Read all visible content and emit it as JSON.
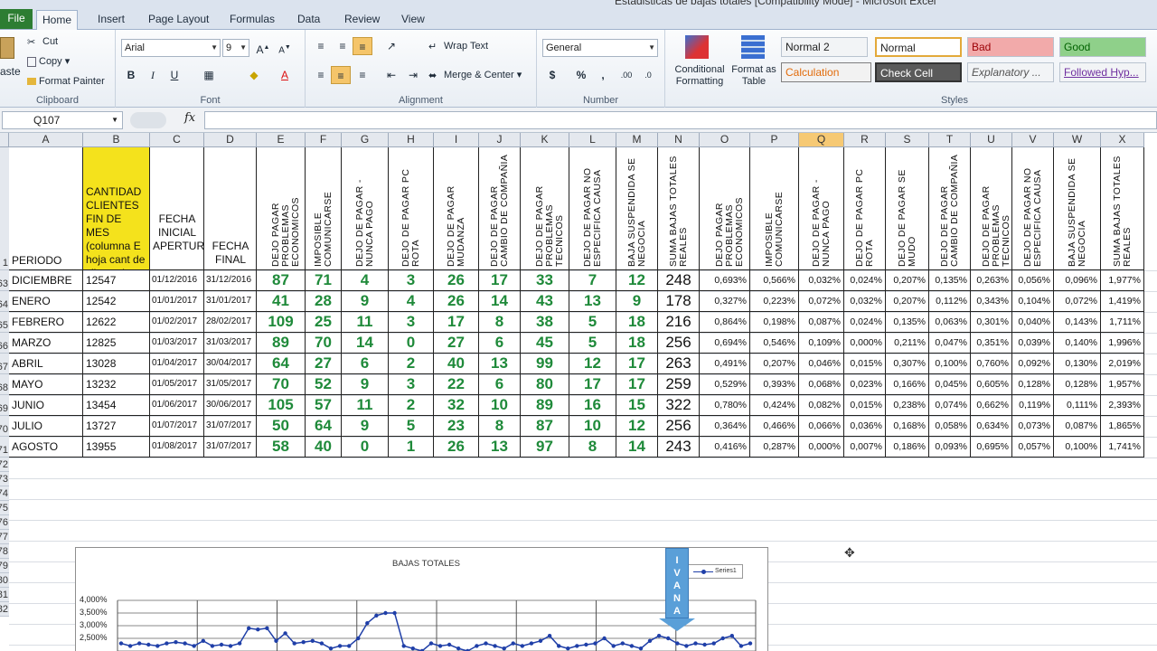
{
  "window": {
    "title": "Estadisticas de bajas totales [Compatibility Mode] - Microsoft Excel"
  },
  "ribbon_tabs": [
    "File",
    "Home",
    "Insert",
    "Page Layout",
    "Formulas",
    "Data",
    "Review",
    "View"
  ],
  "clipboard": {
    "paste": "aste",
    "cut": "Cut",
    "copy": "Copy",
    "format_painter": "Format Painter",
    "label": "Clipboard"
  },
  "font": {
    "name": "Arial",
    "size": "9",
    "label": "Font",
    "bold": "B",
    "italic": "I",
    "underline": "U"
  },
  "alignment": {
    "wrap_text": "Wrap Text",
    "merge_center": "Merge & Center",
    "label": "Alignment"
  },
  "number": {
    "format": "General",
    "currency": "$",
    "percent": "%",
    "comma": ",",
    "label": "Number"
  },
  "styles": {
    "conditional_formatting": "Conditional Formatting",
    "format_as_table": "Format as Table",
    "label": "Styles",
    "cells": [
      "Normal 2",
      "Normal",
      "Bad",
      "Good",
      "Calculation",
      "Check Cell",
      "Explanatory ...",
      "Followed Hyp..."
    ]
  },
  "formula_bar": {
    "name_box": "Q107",
    "fx": "fx",
    "value": ""
  },
  "columns": [
    "A",
    "B",
    "C",
    "D",
    "E",
    "F",
    "G",
    "H",
    "I",
    "J",
    "K",
    "L",
    "M",
    "N",
    "O",
    "P",
    "Q",
    "R",
    "S",
    "T",
    "U",
    "V",
    "W",
    "X"
  ],
  "selected_column": "Q",
  "header_row": {
    "row_number": "1",
    "a": "PERIODO",
    "b": "CANTIDAD CLIENTES FIN DE MES (columna E hoja cant de clientes)",
    "c": "FECHA INICIAL APERTURA",
    "d": "FECHA FINAL",
    "vertical": [
      "DEJO PAGAR PROBLEMAS ECONOMICOS",
      "IMPOSIBLE COMUNICARSE",
      "DEJO DE PAGAR - NUNCA PAGO",
      "DEJO DE PAGAR PC ROTA",
      "DEJO DE PAGAR MUDANZA",
      "DEJO DE PAGAR CAMBIO DE COMPAÑIA",
      "DEJO DE PAGAR PROBLEMAS TECNICOS",
      "DEJO DE PAGAR NO ESPECIFICA CAUSA",
      "BAJA SUSPENDIDA SE NEGOCIA",
      "SUMA BAJAS TOTALES REALES",
      "DEJO PAGAR PROBLEMAS ECONOMICOS",
      "IMPOSIBLE COMUNICARSE",
      "DEJO DE PAGAR - NUNCA PAGO",
      "DEJO DE PAGAR PC ROTA",
      "DEJO DE PAGAR SE MUDO",
      "DEJO DE PAGAR CAMBIO DE COMPAÑIA",
      "DEJO DE PAGAR PROBLEMAS TECNICOS",
      "DEJO DE PAGAR NO ESPECIFICA CAUSA",
      "BAJA SUSPENDIDA SE NEGOCIA",
      "SUMA BAJAS TOTALES REALES"
    ]
  },
  "rows": [
    {
      "num": "63",
      "periodo": "DICIEMBRE",
      "clientes": "12547",
      "inicio": "01/12/2016",
      "fin": "31/12/2016",
      "counts": [
        "87",
        "71",
        "4",
        "3",
        "26",
        "17",
        "33",
        "7",
        "12",
        "248"
      ],
      "pcts": [
        "0,693%",
        "0,566%",
        "0,032%",
        "0,024%",
        "0,207%",
        "0,135%",
        "0,263%",
        "0,056%",
        "0,096%",
        "1,977%"
      ]
    },
    {
      "num": "64",
      "periodo": "ENERO",
      "clientes": "12542",
      "inicio": "01/01/2017",
      "fin": "31/01/2017",
      "counts": [
        "41",
        "28",
        "9",
        "4",
        "26",
        "14",
        "43",
        "13",
        "9",
        "178"
      ],
      "pcts": [
        "0,327%",
        "0,223%",
        "0,072%",
        "0,032%",
        "0,207%",
        "0,112%",
        "0,343%",
        "0,104%",
        "0,072%",
        "1,419%"
      ]
    },
    {
      "num": "65",
      "periodo": "FEBRERO",
      "clientes": "12622",
      "inicio": "01/02/2017",
      "fin": "28/02/2017",
      "counts": [
        "109",
        "25",
        "11",
        "3",
        "17",
        "8",
        "38",
        "5",
        "18",
        "216"
      ],
      "pcts": [
        "0,864%",
        "0,198%",
        "0,087%",
        "0,024%",
        "0,135%",
        "0,063%",
        "0,301%",
        "0,040%",
        "0,143%",
        "1,711%"
      ]
    },
    {
      "num": "66",
      "periodo": "MARZO",
      "clientes": "12825",
      "inicio": "01/03/2017",
      "fin": "31/03/2017",
      "counts": [
        "89",
        "70",
        "14",
        "0",
        "27",
        "6",
        "45",
        "5",
        "18",
        "256"
      ],
      "pcts": [
        "0,694%",
        "0,546%",
        "0,109%",
        "0,000%",
        "0,211%",
        "0,047%",
        "0,351%",
        "0,039%",
        "0,140%",
        "1,996%"
      ]
    },
    {
      "num": "67",
      "periodo": "ABRIL",
      "clientes": "13028",
      "inicio": "01/04/2017",
      "fin": "30/04/2017",
      "counts": [
        "64",
        "27",
        "6",
        "2",
        "40",
        "13",
        "99",
        "12",
        "17",
        "263"
      ],
      "pcts": [
        "0,491%",
        "0,207%",
        "0,046%",
        "0,015%",
        "0,307%",
        "0,100%",
        "0,760%",
        "0,092%",
        "0,130%",
        "2,019%"
      ]
    },
    {
      "num": "68",
      "periodo": "MAYO",
      "clientes": "13232",
      "inicio": "01/05/2017",
      "fin": "31/05/2017",
      "counts": [
        "70",
        "52",
        "9",
        "3",
        "22",
        "6",
        "80",
        "17",
        "17",
        "259"
      ],
      "pcts": [
        "0,529%",
        "0,393%",
        "0,068%",
        "0,023%",
        "0,166%",
        "0,045%",
        "0,605%",
        "0,128%",
        "0,128%",
        "1,957%"
      ]
    },
    {
      "num": "69",
      "periodo": "JUNIO",
      "clientes": "13454",
      "inicio": "01/06/2017",
      "fin": "30/06/2017",
      "counts": [
        "105",
        "57",
        "11",
        "2",
        "32",
        "10",
        "89",
        "16",
        "15",
        "322"
      ],
      "pcts": [
        "0,780%",
        "0,424%",
        "0,082%",
        "0,015%",
        "0,238%",
        "0,074%",
        "0,662%",
        "0,119%",
        "0,111%",
        "2,393%"
      ]
    },
    {
      "num": "70",
      "periodo": "JULIO",
      "clientes": "13727",
      "inicio": "01/07/2017",
      "fin": "31/07/2017",
      "counts": [
        "50",
        "64",
        "9",
        "5",
        "23",
        "8",
        "87",
        "10",
        "12",
        "256"
      ],
      "pcts": [
        "0,364%",
        "0,466%",
        "0,066%",
        "0,036%",
        "0,168%",
        "0,058%",
        "0,634%",
        "0,073%",
        "0,087%",
        "1,865%"
      ]
    },
    {
      "num": "71",
      "periodo": "AGOSTO",
      "clientes": "13955",
      "inicio": "01/08/2017",
      "fin": "31/07/2017",
      "counts": [
        "58",
        "40",
        "0",
        "1",
        "26",
        "13",
        "97",
        "8",
        "14",
        "243"
      ],
      "pcts": [
        "0,416%",
        "0,287%",
        "0,000%",
        "0,007%",
        "0,186%",
        "0,093%",
        "0,695%",
        "0,057%",
        "0,100%",
        "1,741%"
      ]
    }
  ],
  "empty_rows": [
    "72",
    "73",
    "74",
    "75",
    "76",
    "77",
    "78",
    "79",
    "80",
    "81",
    "82"
  ],
  "chart": {
    "title": "BAJAS TOTALES",
    "legend": "Series1",
    "yticks": [
      "4,000%",
      "3,500%",
      "3,000%",
      "2,500%"
    ],
    "annotation": "IVANA"
  },
  "chart_data": {
    "type": "line",
    "title": "BAJAS TOTALES",
    "series": [
      {
        "name": "Series1",
        "values": [
          2.3,
          2.2,
          2.3,
          2.25,
          2.2,
          2.3,
          2.35,
          2.3,
          2.2,
          2.4,
          2.2,
          2.25,
          2.2,
          2.3,
          2.9,
          2.85,
          2.9,
          2.4,
          2.7,
          2.3,
          2.35,
          2.4,
          2.3,
          2.1,
          2.2,
          2.2,
          2.5,
          3.1,
          3.4,
          3.5,
          3.5,
          2.2,
          2.1,
          2.0,
          2.3,
          2.2,
          2.25,
          2.1,
          2.0,
          2.2,
          2.3,
          2.2,
          2.1,
          2.3,
          2.2,
          2.3,
          2.4,
          2.6,
          2.2,
          2.1,
          2.2,
          2.25,
          2.3,
          2.5,
          2.2,
          2.3,
          2.2,
          2.1,
          2.4,
          2.6,
          2.5,
          2.3,
          2.2,
          2.3,
          2.25,
          2.3,
          2.5,
          2.6,
          2.2,
          2.3
        ]
      }
    ],
    "ylim": [
      2.0,
      4.0
    ],
    "yunit": "%",
    "yticks": [
      "4,000%",
      "3,500%",
      "3,000%",
      "2,500%"
    ]
  },
  "colors": {
    "green_numbers": "#1f8a3a",
    "highlight_yellow": "#f4e21c",
    "selected_col": "#f6c974"
  }
}
